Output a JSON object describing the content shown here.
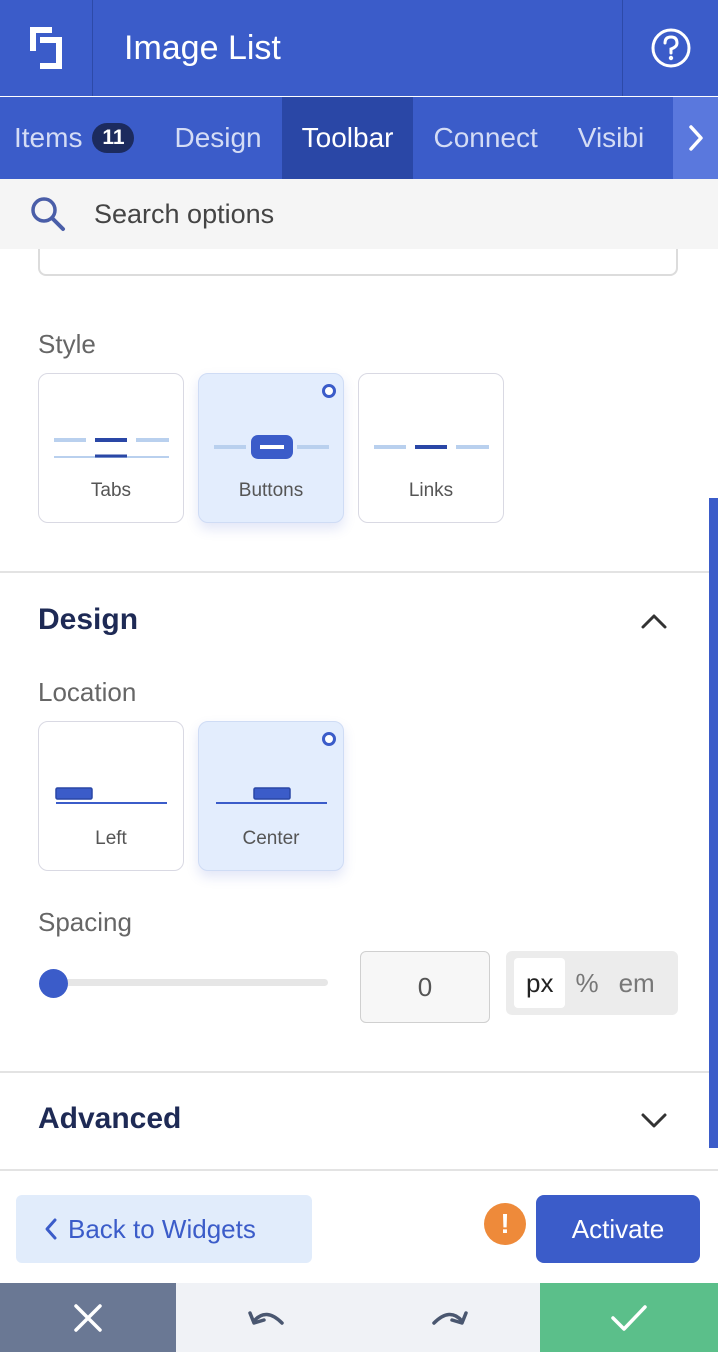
{
  "header": {
    "title": "Image List",
    "logo_icon": "app-logo-icon",
    "help_icon": "help-circle-icon"
  },
  "tabs": [
    {
      "label": "Items",
      "badge": "11"
    },
    {
      "label": "Design"
    },
    {
      "label": "Toolbar",
      "active": true
    },
    {
      "label": "Connect"
    },
    {
      "label": "Visibi"
    }
  ],
  "search": {
    "placeholder": "Search options"
  },
  "style": {
    "label": "Style",
    "options": [
      {
        "label": "Tabs",
        "selected": false
      },
      {
        "label": "Buttons",
        "selected": true
      },
      {
        "label": "Links",
        "selected": false
      }
    ]
  },
  "design": {
    "title": "Design",
    "location": {
      "label": "Location",
      "options": [
        {
          "label": "Left",
          "selected": false
        },
        {
          "label": "Center",
          "selected": true
        }
      ]
    },
    "spacing": {
      "label": "Spacing",
      "value": "0",
      "units": [
        "px",
        "%",
        "em"
      ],
      "active_unit": "px"
    }
  },
  "advanced": {
    "title": "Advanced"
  },
  "footer": {
    "back_label": "Back to Widgets",
    "warning_symbol": "!",
    "activate_label": "Activate"
  },
  "colors": {
    "primary": "#3b5cc9",
    "dark_tab": "#2a47a6",
    "warning": "#ee8a3a",
    "success": "#5bbf8a",
    "slate": "#6a7894"
  }
}
